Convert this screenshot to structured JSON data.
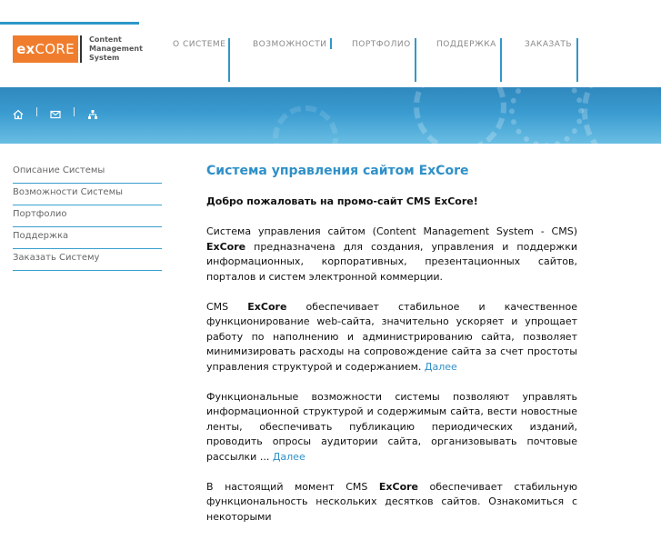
{
  "header": {
    "logo": {
      "brand_prefix": "ex",
      "brand_suffix": "CORE",
      "line1": "Content",
      "line2": "Management",
      "line3": "System"
    },
    "nav": [
      {
        "label": "О СИСТЕМЕ"
      },
      {
        "label": "ВОЗМОЖНОСТИ"
      },
      {
        "label": "ПОРТФОЛИО"
      },
      {
        "label": "ПОДДЕРЖКА"
      },
      {
        "label": "ЗАКАЗАТЬ"
      }
    ],
    "colors": {
      "accent": "#2f98c9",
      "logo_bg": "#f07d2d"
    }
  },
  "banner": {
    "icons": [
      "home-icon",
      "mail-icon",
      "sitemap-icon"
    ]
  },
  "sidebar": {
    "items": [
      {
        "label": "Описание Системы"
      },
      {
        "label": "Возможности Системы"
      },
      {
        "label": "Портфолио"
      },
      {
        "label": "Поддержка"
      },
      {
        "label": "Заказать Систему"
      }
    ]
  },
  "content": {
    "title": "Система управления сайтом ExCore",
    "welcome": "Добро пожаловать на промо-сайт CMS ExCore!",
    "p1_pre": "Система управления сайтом (Content Management System - CMS) ",
    "p1_bold": "ExCore",
    "p1_post": " предназначена для создания, управления и поддержки информационных, корпоративных, презентационных сайтов, порталов и систем электронной коммерции.",
    "p2_pre": "CMS ",
    "p2_bold": "ExCore",
    "p2_post": " обеспечивает стабильное и качественное функционирование web-сайта, значительно ускоряет и упрощает работу по наполнению и администрированию сайта, позволяет минимизировать расходы на сопровождение сайта за счет простоты управления структурой и содержанием. ",
    "p2_link": "Далее",
    "p3_text": "Функциональные возможности системы позволяют управлять информационной структурой и содержимым сайта, вести новостные ленты, обеспечивать публикацию периодических изданий, проводить опросы аудитории сайта, организовывать почтовые рассылки ... ",
    "p3_link": "Далее",
    "p4_pre": "В настоящий момент CMS ",
    "p4_bold": "ExCore",
    "p4_post": " обеспечивает стабильную функциональность нескольких десятков сайтов. Ознакомиться с некоторыми"
  }
}
